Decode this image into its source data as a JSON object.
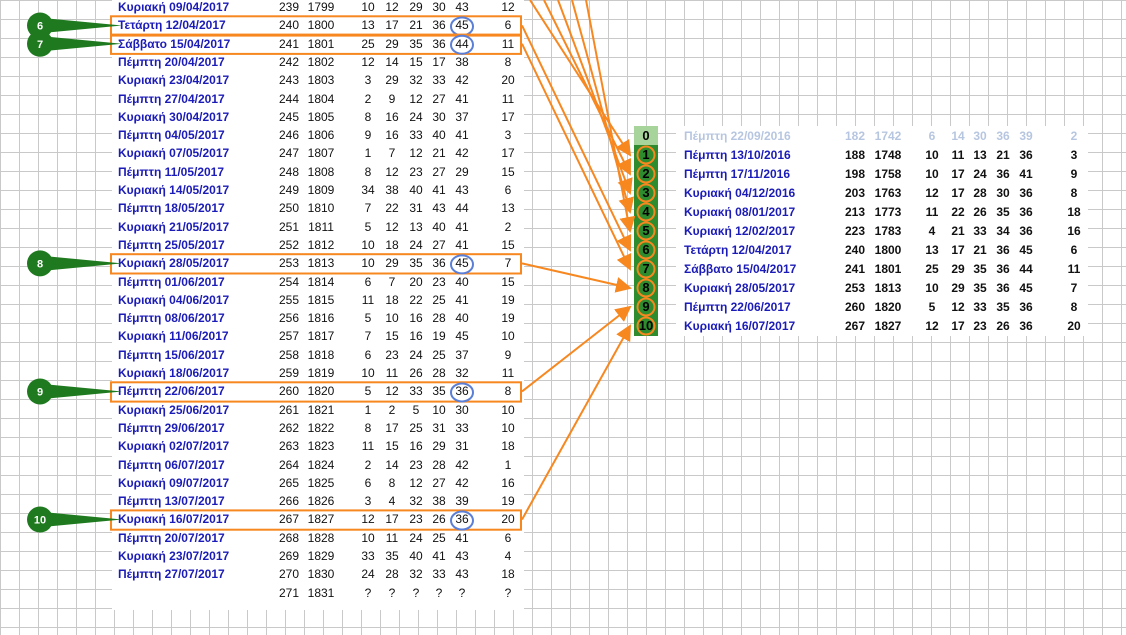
{
  "left_table": [
    {
      "date": "Κυριακή 09/04/2017",
      "a": "239",
      "b": "1799",
      "n1": "10",
      "n2": "12",
      "n3": "29",
      "n4": "30",
      "n5": "43",
      "x": "12"
    },
    {
      "date": "Τετάρτη 12/04/2017",
      "a": "240",
      "b": "1800",
      "n1": "13",
      "n2": "17",
      "n3": "21",
      "n4": "36",
      "n5": "45",
      "x": "6"
    },
    {
      "date": "Σάββατο 15/04/2017",
      "a": "241",
      "b": "1801",
      "n1": "25",
      "n2": "29",
      "n3": "35",
      "n4": "36",
      "n5": "44",
      "x": "11"
    },
    {
      "date": "Πέμπτη 20/04/2017",
      "a": "242",
      "b": "1802",
      "n1": "12",
      "n2": "14",
      "n3": "15",
      "n4": "17",
      "n5": "38",
      "x": "8"
    },
    {
      "date": "Κυριακή 23/04/2017",
      "a": "243",
      "b": "1803",
      "n1": "3",
      "n2": "29",
      "n3": "32",
      "n4": "33",
      "n5": "42",
      "x": "20"
    },
    {
      "date": "Πέμπτη 27/04/2017",
      "a": "244",
      "b": "1804",
      "n1": "2",
      "n2": "9",
      "n3": "12",
      "n4": "27",
      "n5": "41",
      "x": "11"
    },
    {
      "date": "Κυριακή 30/04/2017",
      "a": "245",
      "b": "1805",
      "n1": "8",
      "n2": "16",
      "n3": "24",
      "n4": "30",
      "n5": "37",
      "x": "17"
    },
    {
      "date": "Πέμπτη 04/05/2017",
      "a": "246",
      "b": "1806",
      "n1": "9",
      "n2": "16",
      "n3": "33",
      "n4": "40",
      "n5": "41",
      "x": "3"
    },
    {
      "date": "Κυριακή 07/05/2017",
      "a": "247",
      "b": "1807",
      "n1": "1",
      "n2": "7",
      "n3": "12",
      "n4": "21",
      "n5": "42",
      "x": "17"
    },
    {
      "date": "Πέμπτη 11/05/2017",
      "a": "248",
      "b": "1808",
      "n1": "8",
      "n2": "12",
      "n3": "23",
      "n4": "27",
      "n5": "29",
      "x": "15"
    },
    {
      "date": "Κυριακή 14/05/2017",
      "a": "249",
      "b": "1809",
      "n1": "34",
      "n2": "38",
      "n3": "40",
      "n4": "41",
      "n5": "43",
      "x": "6"
    },
    {
      "date": "Πέμπτη 18/05/2017",
      "a": "250",
      "b": "1810",
      "n1": "7",
      "n2": "22",
      "n3": "31",
      "n4": "43",
      "n5": "44",
      "x": "13"
    },
    {
      "date": "Κυριακή 21/05/2017",
      "a": "251",
      "b": "1811",
      "n1": "5",
      "n2": "12",
      "n3": "13",
      "n4": "40",
      "n5": "41",
      "x": "2"
    },
    {
      "date": "Πέμπτη 25/05/2017",
      "a": "252",
      "b": "1812",
      "n1": "10",
      "n2": "18",
      "n3": "24",
      "n4": "27",
      "n5": "41",
      "x": "15"
    },
    {
      "date": "Κυριακή 28/05/2017",
      "a": "253",
      "b": "1813",
      "n1": "10",
      "n2": "29",
      "n3": "35",
      "n4": "36",
      "n5": "45",
      "x": "7"
    },
    {
      "date": "Πέμπτη 01/06/2017",
      "a": "254",
      "b": "1814",
      "n1": "6",
      "n2": "7",
      "n3": "20",
      "n4": "23",
      "n5": "40",
      "x": "15"
    },
    {
      "date": "Κυριακή 04/06/2017",
      "a": "255",
      "b": "1815",
      "n1": "11",
      "n2": "18",
      "n3": "22",
      "n4": "25",
      "n5": "41",
      "x": "19"
    },
    {
      "date": "Πέμπτη 08/06/2017",
      "a": "256",
      "b": "1816",
      "n1": "5",
      "n2": "10",
      "n3": "16",
      "n4": "28",
      "n5": "40",
      "x": "19"
    },
    {
      "date": "Κυριακή 11/06/2017",
      "a": "257",
      "b": "1817",
      "n1": "7",
      "n2": "15",
      "n3": "16",
      "n4": "19",
      "n5": "45",
      "x": "10"
    },
    {
      "date": "Πέμπτη 15/06/2017",
      "a": "258",
      "b": "1818",
      "n1": "6",
      "n2": "23",
      "n3": "24",
      "n4": "25",
      "n5": "37",
      "x": "9"
    },
    {
      "date": "Κυριακή 18/06/2017",
      "a": "259",
      "b": "1819",
      "n1": "10",
      "n2": "11",
      "n3": "26",
      "n4": "28",
      "n5": "32",
      "x": "11"
    },
    {
      "date": "Πέμπτη 22/06/2017",
      "a": "260",
      "b": "1820",
      "n1": "5",
      "n2": "12",
      "n3": "33",
      "n4": "35",
      "n5": "36",
      "x": "8"
    },
    {
      "date": "Κυριακή 25/06/2017",
      "a": "261",
      "b": "1821",
      "n1": "1",
      "n2": "2",
      "n3": "5",
      "n4": "10",
      "n5": "30",
      "x": "10"
    },
    {
      "date": "Πέμπτη 29/06/2017",
      "a": "262",
      "b": "1822",
      "n1": "8",
      "n2": "17",
      "n3": "25",
      "n4": "31",
      "n5": "33",
      "x": "10"
    },
    {
      "date": "Κυριακή 02/07/2017",
      "a": "263",
      "b": "1823",
      "n1": "11",
      "n2": "15",
      "n3": "16",
      "n4": "29",
      "n5": "31",
      "x": "18"
    },
    {
      "date": "Πέμπτη 06/07/2017",
      "a": "264",
      "b": "1824",
      "n1": "2",
      "n2": "14",
      "n3": "23",
      "n4": "28",
      "n5": "42",
      "x": "1"
    },
    {
      "date": "Κυριακή 09/07/2017",
      "a": "265",
      "b": "1825",
      "n1": "6",
      "n2": "8",
      "n3": "12",
      "n4": "27",
      "n5": "42",
      "x": "16"
    },
    {
      "date": "Πέμπτη 13/07/2017",
      "a": "266",
      "b": "1826",
      "n1": "3",
      "n2": "4",
      "n3": "32",
      "n4": "38",
      "n5": "39",
      "x": "19"
    },
    {
      "date": "Κυριακή 16/07/2017",
      "a": "267",
      "b": "1827",
      "n1": "12",
      "n2": "17",
      "n3": "23",
      "n4": "26",
      "n5": "36",
      "x": "20"
    },
    {
      "date": "Πέμπτη 20/07/2017",
      "a": "268",
      "b": "1828",
      "n1": "10",
      "n2": "11",
      "n3": "24",
      "n4": "25",
      "n5": "41",
      "x": "6"
    },
    {
      "date": "Κυριακή 23/07/2017",
      "a": "269",
      "b": "1829",
      "n1": "33",
      "n2": "35",
      "n3": "40",
      "n4": "41",
      "n5": "43",
      "x": "4"
    },
    {
      "date": "Πέμπτη 27/07/2017",
      "a": "270",
      "b": "1830",
      "n1": "24",
      "n2": "28",
      "n3": "32",
      "n4": "33",
      "n5": "43",
      "x": "18"
    },
    {
      "date": "",
      "a": "271",
      "b": "1831",
      "n1": "?",
      "n2": "?",
      "n3": "?",
      "n4": "?",
      "n5": "?",
      "x": "?"
    }
  ],
  "right_table": [
    {
      "date": "Πέμπτη 22/09/2016",
      "a": "182",
      "b": "1742",
      "n1": "6",
      "n2": "14",
      "n3": "30",
      "n4": "36",
      "n5": "39",
      "x": "2"
    },
    {
      "date": "Πέμπτη 13/10/2016",
      "a": "188",
      "b": "1748",
      "n1": "10",
      "n2": "11",
      "n3": "13",
      "n4": "21",
      "n5": "36",
      "x": "3"
    },
    {
      "date": "Πέμπτη 17/11/2016",
      "a": "198",
      "b": "1758",
      "n1": "10",
      "n2": "17",
      "n3": "24",
      "n4": "36",
      "n5": "41",
      "x": "9"
    },
    {
      "date": "Κυριακή 04/12/2016",
      "a": "203",
      "b": "1763",
      "n1": "12",
      "n2": "17",
      "n3": "28",
      "n4": "30",
      "n5": "36",
      "x": "8"
    },
    {
      "date": "Κυριακή 08/01/2017",
      "a": "213",
      "b": "1773",
      "n1": "11",
      "n2": "22",
      "n3": "26",
      "n4": "35",
      "n5": "36",
      "x": "18"
    },
    {
      "date": "Κυριακή 12/02/2017",
      "a": "223",
      "b": "1783",
      "n1": "4",
      "n2": "21",
      "n3": "33",
      "n4": "34",
      "n5": "36",
      "x": "16"
    },
    {
      "date": "Τετάρτη 12/04/2017",
      "a": "240",
      "b": "1800",
      "n1": "13",
      "n2": "17",
      "n3": "21",
      "n4": "36",
      "n5": "45",
      "x": "6"
    },
    {
      "date": "Σάββατο 15/04/2017",
      "a": "241",
      "b": "1801",
      "n1": "25",
      "n2": "29",
      "n3": "35",
      "n4": "36",
      "n5": "44",
      "x": "11"
    },
    {
      "date": "Κυριακή 28/05/2017",
      "a": "253",
      "b": "1813",
      "n1": "10",
      "n2": "29",
      "n3": "35",
      "n4": "36",
      "n5": "45",
      "x": "7"
    },
    {
      "date": "Πέμπτη 22/06/2017",
      "a": "260",
      "b": "1820",
      "n1": "5",
      "n2": "12",
      "n3": "33",
      "n4": "35",
      "n5": "36",
      "x": "8"
    },
    {
      "date": "Κυριακή 16/07/2017",
      "a": "267",
      "b": "1827",
      "n1": "12",
      "n2": "17",
      "n3": "23",
      "n4": "26",
      "n5": "36",
      "x": "20"
    }
  ],
  "sequence_labels": [
    "0",
    "1",
    "2",
    "3",
    "4",
    "5",
    "6",
    "7",
    "8",
    "9",
    "10"
  ],
  "callouts": [
    "6",
    "7",
    "8",
    "9",
    "10"
  ],
  "colors": {
    "date": "#1b1bb8",
    "highlight": "#f7871f",
    "callout": "#1f7a1f",
    "circle": "#5b7fd6",
    "column": "#2e8b2e",
    "faded": "#b7c6e0"
  }
}
